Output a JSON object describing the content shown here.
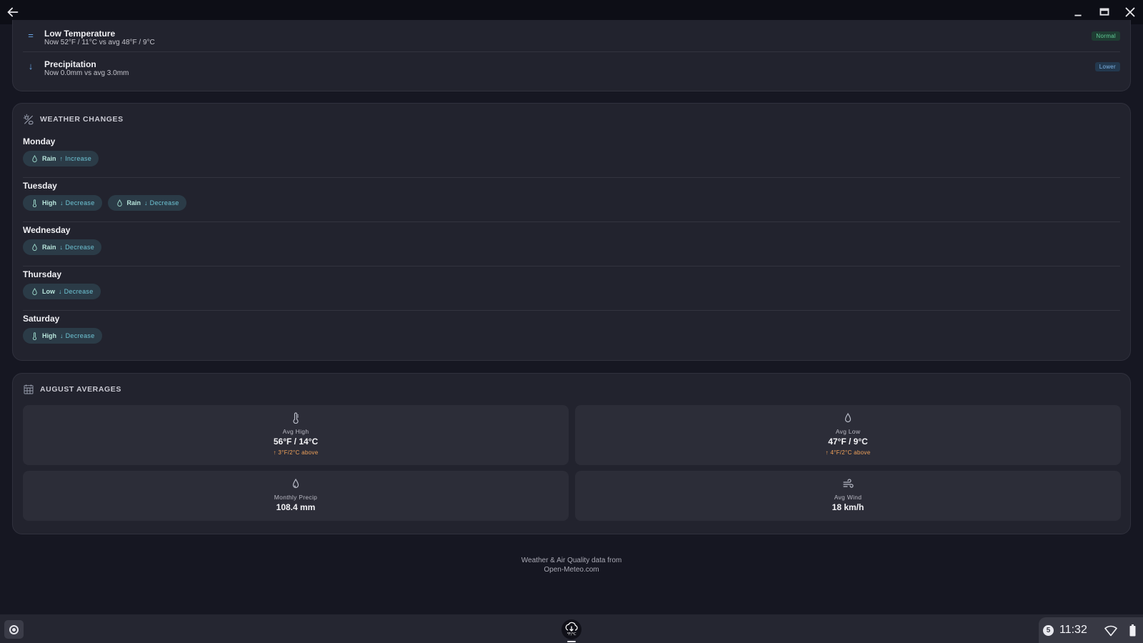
{
  "titlebar": {
    "back_icon": "arrow-left-icon",
    "minimize_icon": "minimize-icon",
    "maximize_icon": "maximize-icon",
    "close_icon": "close-icon"
  },
  "comparison": {
    "rows": [
      {
        "icon": "equals-icon",
        "glyph": "=",
        "title": "Low Temperature",
        "detail": "Now 52°F / 11°C vs avg 48°F / 9°C",
        "badge": "Normal"
      },
      {
        "icon": "arrow-down-icon",
        "glyph": "↓",
        "title": "Precipitation",
        "detail": "Now 0.0mm vs avg 3.0mm",
        "badge": "Lower"
      }
    ]
  },
  "weather_changes": {
    "icon": "weather-change-icon",
    "title": "WEATHER CHANGES",
    "days": [
      {
        "name": "Monday",
        "changes": [
          {
            "icon": "droplet-icon",
            "variable": "Rain",
            "direction": "↑ Increase"
          }
        ]
      },
      {
        "name": "Tuesday",
        "changes": [
          {
            "icon": "thermometer-icon",
            "variable": "High",
            "direction": "↓ Decrease"
          },
          {
            "icon": "droplet-icon",
            "variable": "Rain",
            "direction": "↓ Decrease"
          }
        ]
      },
      {
        "name": "Wednesday",
        "changes": [
          {
            "icon": "droplet-icon",
            "variable": "Rain",
            "direction": "↓ Decrease"
          }
        ]
      },
      {
        "name": "Thursday",
        "changes": [
          {
            "icon": "droplet-icon",
            "variable": "Low",
            "direction": "↓ Decrease"
          }
        ]
      },
      {
        "name": "Saturday",
        "changes": [
          {
            "icon": "thermometer-icon",
            "variable": "High",
            "direction": "↓ Decrease"
          }
        ]
      }
    ]
  },
  "august_averages": {
    "icon": "calendar-grid-icon",
    "title": "AUGUST AVERAGES",
    "tiles": [
      {
        "icon": "thermometer-icon",
        "label": "Avg High",
        "value": "56°F / 14°C",
        "delta": "↑ 3°F/2°C above"
      },
      {
        "icon": "droplet-icon",
        "label": "Avg Low",
        "value": "47°F / 9°C",
        "delta": "↑ 4°F/2°C above"
      },
      {
        "icon": "droplet-icon",
        "label": "Monthly Precip",
        "value": "108.4 mm",
        "delta": ""
      },
      {
        "icon": "wind-icon",
        "label": "Avg Wind",
        "value": "18 km/h",
        "delta": ""
      }
    ]
  },
  "footer": {
    "line1": "Weather & Air Quality data from",
    "line2": "Open-Meteo.com"
  },
  "taskbar": {
    "launcher_icon": "launcher-icon",
    "app_icon": "weather-app-icon",
    "app_icon_label": "°F/°C",
    "notification_count": "5",
    "time": "11:32",
    "wifi_icon": "wifi-icon",
    "battery_icon": "battery-icon"
  },
  "colors": {
    "background": "#161722",
    "card": "#22232e",
    "badge_normal": "#62cc98",
    "badge_lower": "#7eb4e6",
    "chip_direction": "#6ec4d4",
    "delta_warm": "#f0a25a"
  }
}
